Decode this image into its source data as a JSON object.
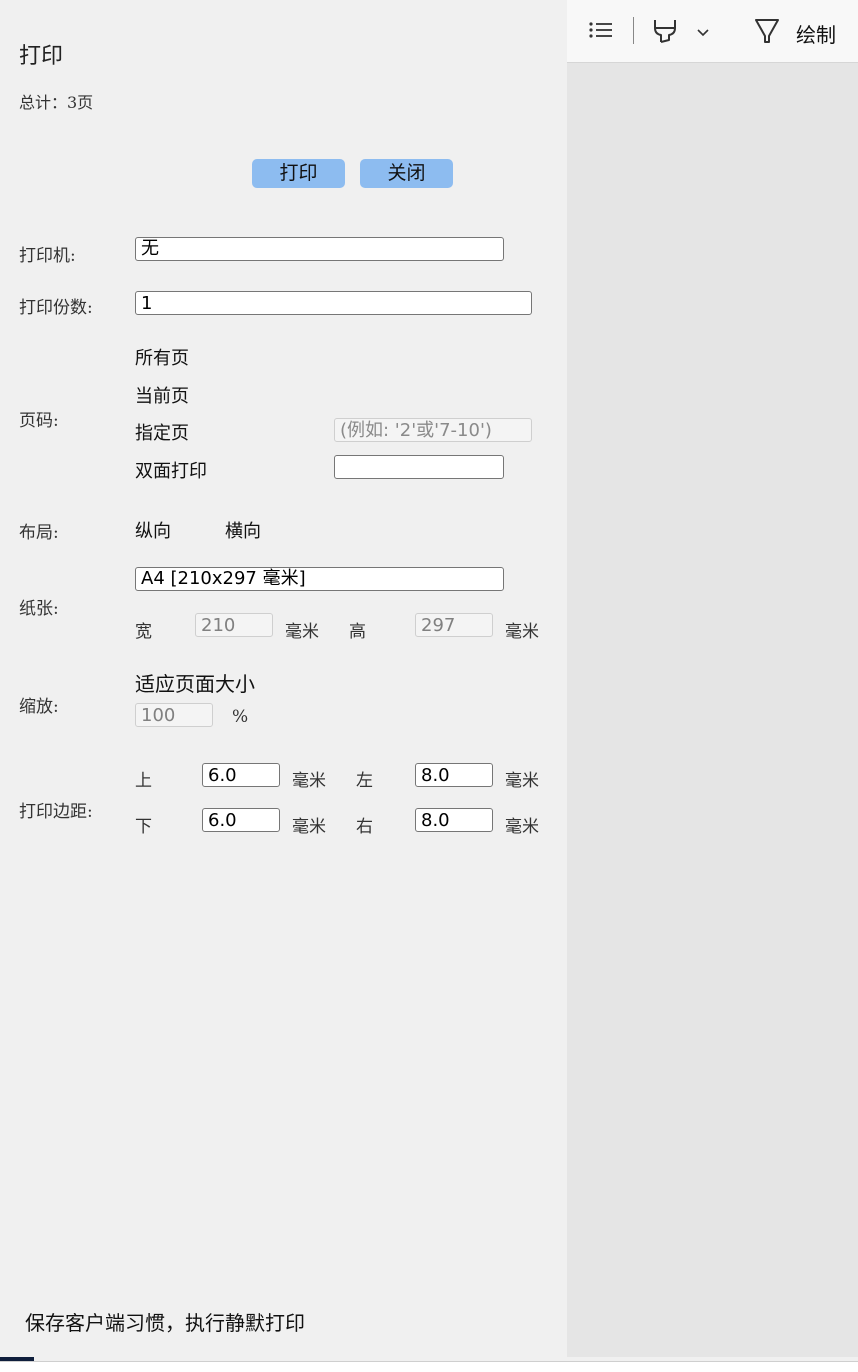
{
  "panel": {
    "title": "打印",
    "total": "总计：3页",
    "print_button": "打印",
    "close_button": "关闭",
    "printer_label": "打印机:",
    "printer_value": "无",
    "copies_label": "打印份数:",
    "copies_value": "1",
    "pages_label": "页码:",
    "pages_options": {
      "all": "所有页",
      "current": "当前页",
      "specified": "指定页",
      "duplex": "双面打印"
    },
    "specified_placeholder": "(例如: '2'或'7-10')",
    "duplex_value": "",
    "layout_label": "布局:",
    "layout_portrait": "纵向",
    "layout_landscape": "横向",
    "paper_label": "纸张:",
    "paper_value": "A4 [210x297 毫米]",
    "width_label": "宽",
    "width_value": "210",
    "height_label": "高",
    "height_value": "297",
    "unit_mm": "毫米",
    "scale_label": "缩放:",
    "scale_fit": "适应页面大小",
    "scale_value": "100",
    "scale_unit": "%",
    "margin_label": "打印边距:",
    "margin_top_label": "上",
    "margin_top_value": "6.0",
    "margin_left_label": "左",
    "margin_left_value": "8.0",
    "margin_bottom_label": "下",
    "margin_bottom_value": "6.0",
    "margin_right_label": "右",
    "margin_right_value": "8.0",
    "footer_text": "保存客户端习惯，执行静默打印"
  },
  "toolbar": {
    "list_icon": "list-icon",
    "highlighter_icon": "highlighter-icon",
    "chevron_icon": "chevron-down-icon",
    "draw_icon": "pen-icon",
    "draw_label": "绘制"
  },
  "colors": {
    "button_bg": "#8dbcf0",
    "panel_bg": "#f0f0f0",
    "viewer_bg": "#e5e5e5"
  }
}
